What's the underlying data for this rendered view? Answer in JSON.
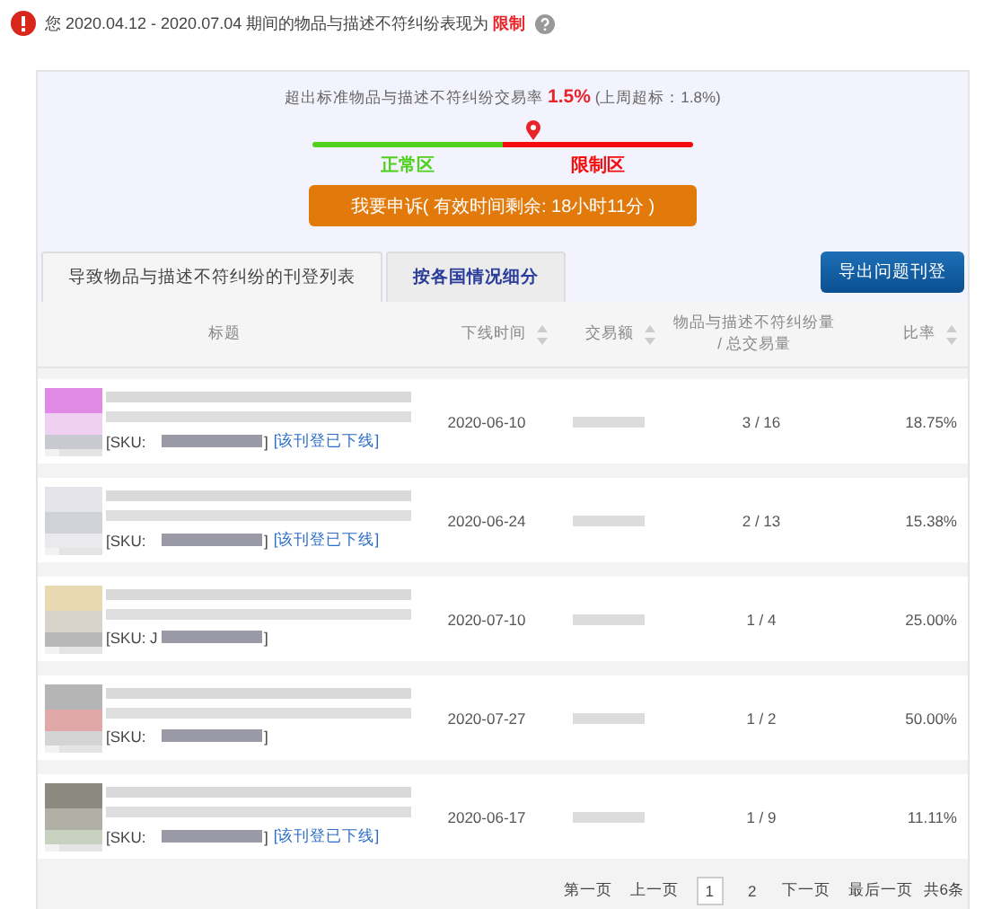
{
  "alert": {
    "prefix": "您",
    "period": "2020.04.12 - 2020.07.04",
    "text": "期间的物品与描述不符纠纷表现为",
    "status": "限制"
  },
  "summary": {
    "label": "超出标准物品与描述不符纠纷交易率",
    "rate": "1.5%",
    "last_week": "(上周超标：1.8%)"
  },
  "gauge": {
    "level": 0.58,
    "normal_label": "正常区",
    "restricted_label": "限制区"
  },
  "appeal_button": "我要申诉( 有效时间剩余: 18小时11分 )",
  "tabs": [
    {
      "label": "导致物品与描述不符纠纷的刊登列表",
      "selected": true
    },
    {
      "label": "按各国情况细分",
      "selected": false
    }
  ],
  "export_button": "导出问题刊登",
  "table": {
    "columns": [
      {
        "label": "标题",
        "sortable": false
      },
      {
        "label": "下线时间",
        "sortable": true
      },
      {
        "label": "交易额",
        "sortable": true
      },
      {
        "label": "物品与描述不符纠纷量\n/ 总交易量",
        "sortable": false
      },
      {
        "label": "比率",
        "sortable": true
      }
    ],
    "rows": [
      {
        "sku_prefix": "[SKU:",
        "sku_suffix": "]",
        "status_link": "[该刊登已下线]",
        "date": "2020-06-10",
        "count": "3 / 16",
        "rate": "18.75%"
      },
      {
        "sku_prefix": "[SKU:",
        "sku_suffix": "]",
        "status_link": "[该刊登已下线]",
        "date": "2020-06-24",
        "count": "2 / 13",
        "rate": "15.38%"
      },
      {
        "sku_prefix": "[SKU: J",
        "sku_suffix": "]",
        "date": "2020-07-10",
        "count": "1 / 4",
        "rate": "25.00%"
      },
      {
        "sku_prefix": "[SKU:",
        "sku_suffix": "]",
        "date": "2020-07-27",
        "count": "1 / 2",
        "rate": "50.00%"
      },
      {
        "sku_prefix": "[SKU:",
        "sku_suffix": "]",
        "status_link": "[该刊登已下线]",
        "date": "2020-06-17",
        "count": "1 / 9",
        "rate": "11.11%"
      }
    ]
  },
  "pagination": {
    "first": "第一页",
    "prev": "上一页",
    "pages": [
      {
        "label": "1",
        "selected": true
      },
      {
        "label": "2",
        "selected": false
      }
    ],
    "next": "下一页",
    "last": "最后一页",
    "total": "共6条"
  }
}
